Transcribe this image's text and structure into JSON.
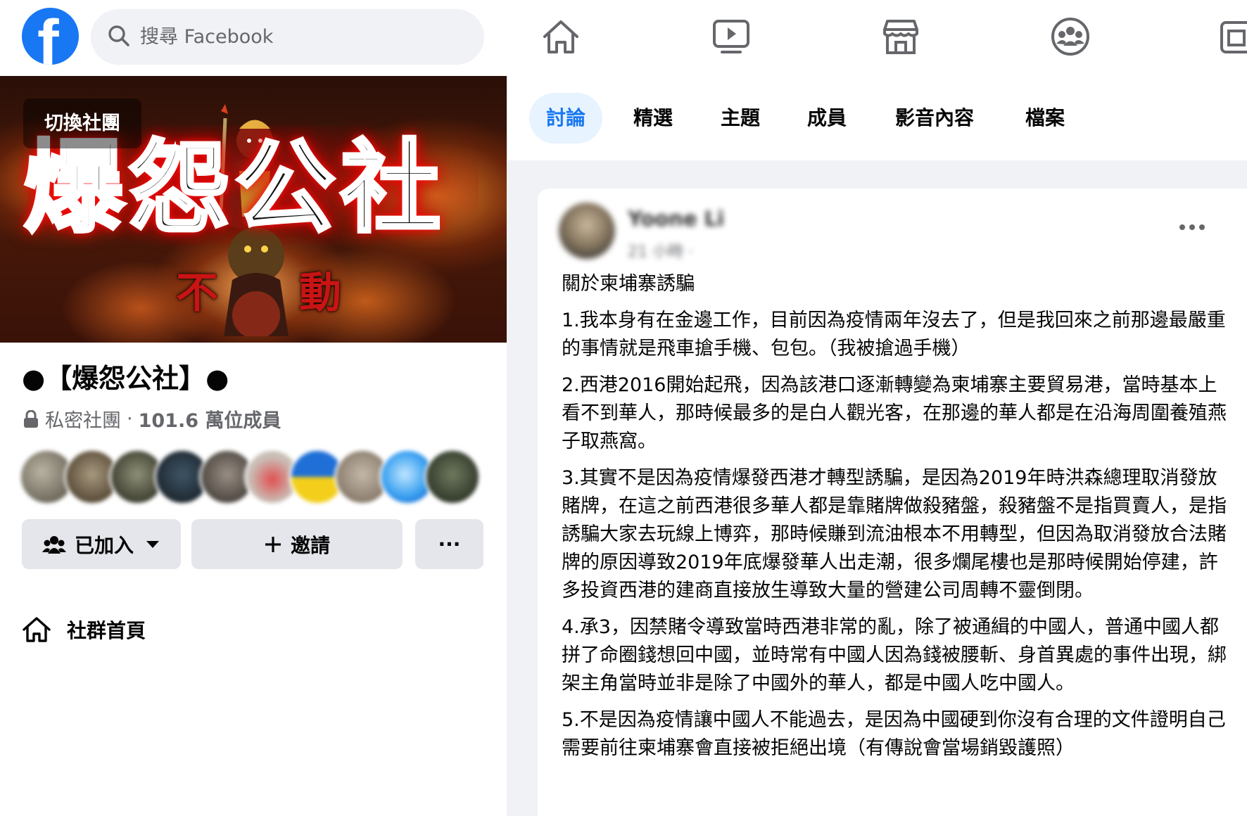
{
  "topbar": {
    "logo_letter": "f",
    "search_placeholder": "搜尋 Facebook",
    "nav_icons": [
      "home-icon",
      "watch-icon",
      "marketplace-icon",
      "groups-icon",
      "gaming-icon"
    ]
  },
  "group": {
    "switch_label": "切換社團",
    "cover_title": "爆怨公社",
    "cover_subtitle": [
      "不",
      "動"
    ],
    "name": "●【爆怨公社】●",
    "privacy": "私密社團",
    "separator": "·",
    "members": "101.6 萬位成員",
    "joined_label": "已加入",
    "invite_label": "邀請",
    "more_label": "···",
    "community_home": "社群首頁"
  },
  "tabs": [
    "討論",
    "精選",
    "主題",
    "成員",
    "影音內容",
    "檔案"
  ],
  "active_tab": "討論",
  "post": {
    "author_name": "Yoone Li",
    "author_time": "21 小時 · ",
    "title": "關於柬埔寨誘騙",
    "paragraphs": [
      "1.我本身有在金邊工作，目前因為疫情兩年沒去了，但是我回來之前那邊最嚴重的事情就是飛車搶手機、包包。（我被搶過手機）",
      "2.西港2016開始起飛，因為該港口逐漸轉變為柬埔寨主要貿易港，當時基本上看不到華人，那時候最多的是白人觀光客，在那邊的華人都是在沿海周圍養殖燕子取燕窩。",
      "3.其實不是因為疫情爆發西港才轉型誘騙，是因為2019年時洪森總理取消發放賭牌，在這之前西港很多華人都是靠賭牌做殺豬盤，殺豬盤不是指買賣人，是指誘騙大家去玩線上博弈，那時候賺到流油根本不用轉型，但因為取消發放合法賭牌的原因導致2019年底爆發華人出走潮，很多爛尾樓也是那時候開始停建，許多投資西港的建商直接放生導致大量的營建公司周轉不靈倒閉。",
      "4.承3，因禁賭令導致當時西港非常的亂，除了被通緝的中國人，普通中國人都拼了命圈錢想回中國，並時常有中國人因為錢被腰斬、身首異處的事件出現，綁架主角當時並非是除了中國外的華人，都是中國人吃中國人。",
      "5.不是因為疫情讓中國人不能過去，是因為中國硬到你沒有合理的文件證明自己需要前往柬埔寨會直接被拒絕出境（有傳說會當場銷毀護照）"
    ]
  },
  "colors": {
    "brand": "#1877f2",
    "page_bg": "#f0f2f5",
    "secondary_text": "#65676b",
    "active_tab_bg": "#e7f3ff",
    "button_bg": "#e4e6eb"
  }
}
